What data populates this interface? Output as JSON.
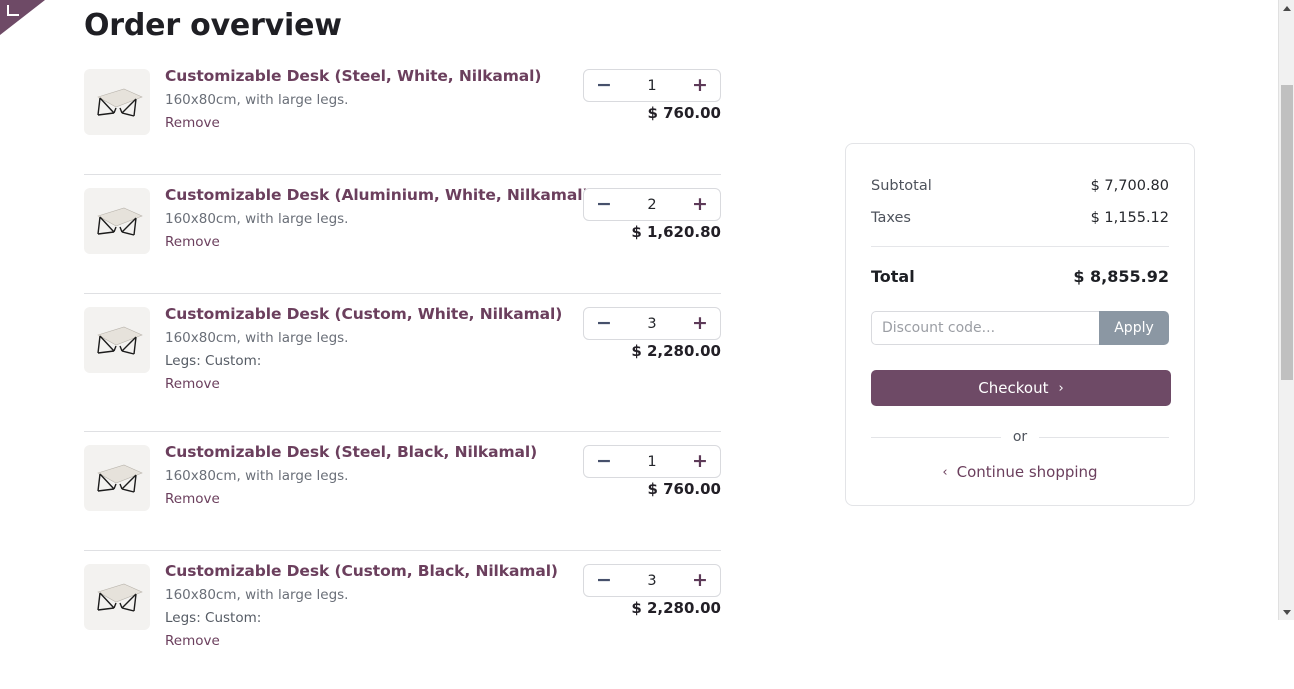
{
  "window": {
    "corner_ribbon_color": "#6e4a66",
    "corner_ribbon_icon": "corner-bracket-icon"
  },
  "page": {
    "title": "Order overview"
  },
  "colors": {
    "brand_purple": "#6e4a66",
    "link_purple": "#6b3f5d",
    "apply_gray": "#8b97a3",
    "text_dark": "#1f1f24",
    "text_muted": "#6a6f78"
  },
  "cart": {
    "items": [
      {
        "title": "Customizable Desk (Steel, White, Nilkamal)",
        "description": "160x80cm, with large legs.",
        "attribute": "",
        "remove_label": "Remove",
        "quantity": "1",
        "price": "$ 760.00",
        "minus_label": "−",
        "plus_label": "+",
        "thumb_icon": "desk-thumbnail"
      },
      {
        "title": "Customizable Desk (Aluminium, White, Nilkamal)",
        "description": "160x80cm, with large legs.",
        "attribute": "",
        "remove_label": "Remove",
        "quantity": "2",
        "price": "$ 1,620.80",
        "minus_label": "−",
        "plus_label": "+",
        "thumb_icon": "desk-thumbnail"
      },
      {
        "title": "Customizable Desk (Custom, White, Nilkamal)",
        "description": "160x80cm, with large legs.",
        "attribute": "Legs: Custom:",
        "remove_label": "Remove",
        "quantity": "3",
        "price": "$ 2,280.00",
        "minus_label": "−",
        "plus_label": "+",
        "thumb_icon": "desk-thumbnail"
      },
      {
        "title": "Customizable Desk (Steel, Black, Nilkamal)",
        "description": "160x80cm, with large legs.",
        "attribute": "",
        "remove_label": "Remove",
        "quantity": "1",
        "price": "$ 760.00",
        "minus_label": "−",
        "plus_label": "+",
        "thumb_icon": "desk-thumbnail"
      },
      {
        "title": "Customizable Desk (Custom, Black, Nilkamal)",
        "description": "160x80cm, with large legs.",
        "attribute": "Legs: Custom:",
        "remove_label": "Remove",
        "quantity": "3",
        "price": "$ 2,280.00",
        "minus_label": "−",
        "plus_label": "+",
        "thumb_icon": "desk-thumbnail"
      }
    ]
  },
  "summary": {
    "subtotal_label": "Subtotal",
    "subtotal_value": "$ 7,700.80",
    "taxes_label": "Taxes",
    "taxes_value": "$ 1,155.12",
    "total_label": "Total",
    "total_value": "$ 8,855.92",
    "discount_placeholder": "Discount code...",
    "discount_value": "",
    "apply_label": "Apply",
    "checkout_label": "Checkout",
    "checkout_chevron": "›",
    "or_label": "or",
    "continue_label": "Continue shopping",
    "continue_chevron": "‹"
  }
}
